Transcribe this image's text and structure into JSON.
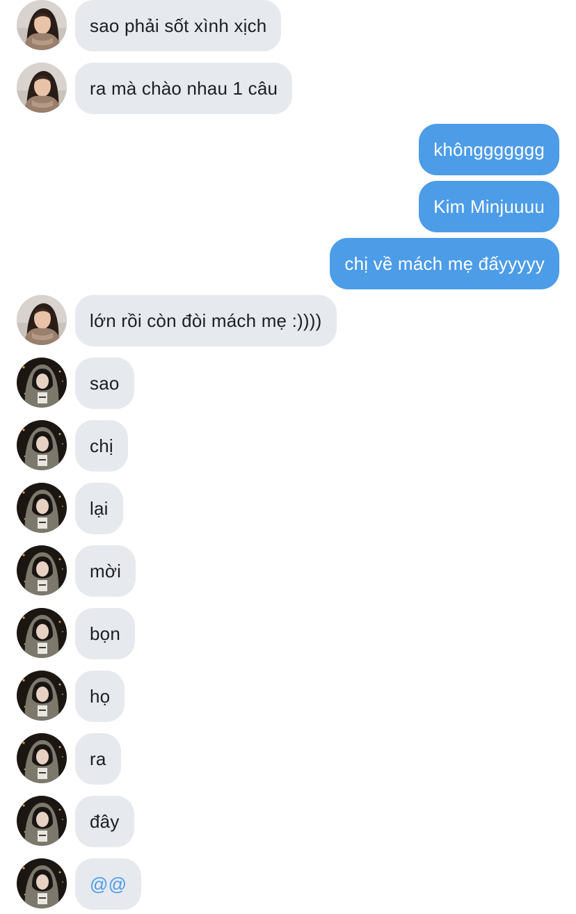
{
  "messages": [
    {
      "from": "contact_a",
      "text": "sao phải sốt xình xịch"
    },
    {
      "from": "contact_a",
      "text": "ra mà chào nhau 1 câu"
    },
    {
      "from": "me",
      "text": "khônggggggg"
    },
    {
      "from": "me",
      "text": "Kim Minjuuuu"
    },
    {
      "from": "me",
      "text": "chị về mách mẹ đấyyyyy"
    },
    {
      "from": "contact_a",
      "text": "lớn rồi còn đòi mách mẹ :))))"
    },
    {
      "from": "contact_b",
      "text": "sao"
    },
    {
      "from": "contact_b",
      "text": "chị"
    },
    {
      "from": "contact_b",
      "text": "lại"
    },
    {
      "from": "contact_b",
      "text": "mời"
    },
    {
      "from": "contact_b",
      "text": "bọn"
    },
    {
      "from": "contact_b",
      "text": "họ"
    },
    {
      "from": "contact_b",
      "text": "ra"
    },
    {
      "from": "contact_b",
      "text": "đây"
    },
    {
      "from": "contact_b",
      "text": "@@",
      "style": "mention"
    }
  ],
  "colors": {
    "incoming_bubble": "#e6e9ee",
    "outgoing_bubble": "#4c9ce8",
    "mention_text": "#4c9ce8"
  }
}
